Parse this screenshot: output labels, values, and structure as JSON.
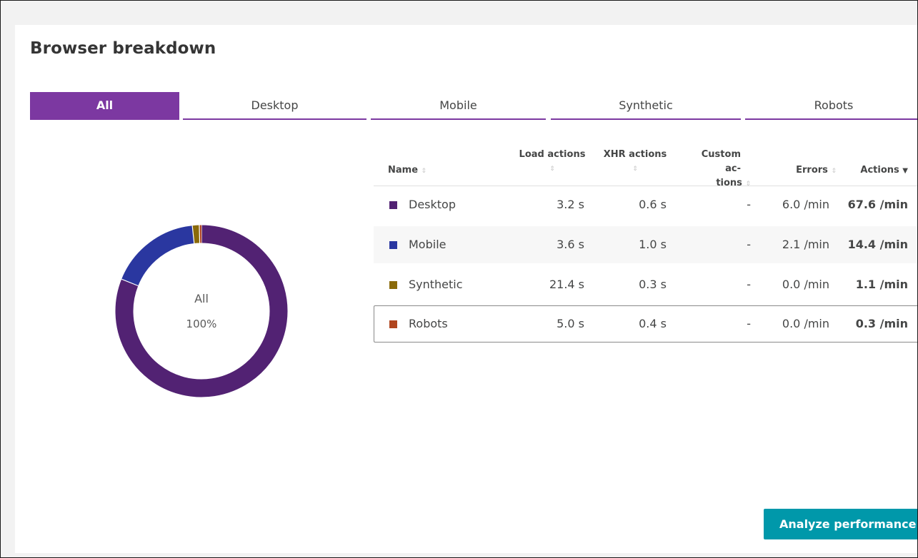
{
  "card": {
    "title": "Browser breakdown"
  },
  "tabs": [
    {
      "label": "All",
      "active": true
    },
    {
      "label": "Desktop",
      "active": false
    },
    {
      "label": "Mobile",
      "active": false
    },
    {
      "label": "Synthetic",
      "active": false
    },
    {
      "label": "Robots",
      "active": false
    }
  ],
  "donut": {
    "center_label": "All",
    "center_value": "100%",
    "segments": [
      {
        "name": "Desktop",
        "share": 0.809,
        "color": "#522273"
      },
      {
        "name": "Mobile",
        "share": 0.172,
        "color": "#2a37a0"
      },
      {
        "name": "Synthetic",
        "share": 0.013,
        "color": "#8a6a0a"
      },
      {
        "name": "Robots",
        "share": 0.004,
        "color": "#b0451f"
      }
    ]
  },
  "table": {
    "columns": {
      "name": "Name",
      "load_line1": "Load actions",
      "xhr_line1": "XHR actions",
      "custom_line1": "Custom ac-",
      "custom_line2": "tions",
      "errors": "Errors",
      "actions": "Actions",
      "sort_icon": "⇕",
      "sort_active_icon": "▼"
    },
    "rows": [
      {
        "name": "Desktop",
        "color": "#522273",
        "load": "3.2 s",
        "xhr": "0.6 s",
        "custom": "-",
        "errors": "6.0 /min",
        "actions": "67.6 /min"
      },
      {
        "name": "Mobile",
        "color": "#2a37a0",
        "load": "3.6 s",
        "xhr": "1.0 s",
        "custom": "-",
        "errors": "2.1 /min",
        "actions": "14.4 /min"
      },
      {
        "name": "Synthetic",
        "color": "#8a6a0a",
        "load": "21.4 s",
        "xhr": "0.3 s",
        "custom": "-",
        "errors": "0.0 /min",
        "actions": "1.1 /min"
      },
      {
        "name": "Robots",
        "color": "#b0451f",
        "load": "5.0 s",
        "xhr": "0.4 s",
        "custom": "-",
        "errors": "0.0 /min",
        "actions": "0.3 /min"
      }
    ]
  },
  "analyze_button": {
    "label": "Analyze performance"
  }
}
